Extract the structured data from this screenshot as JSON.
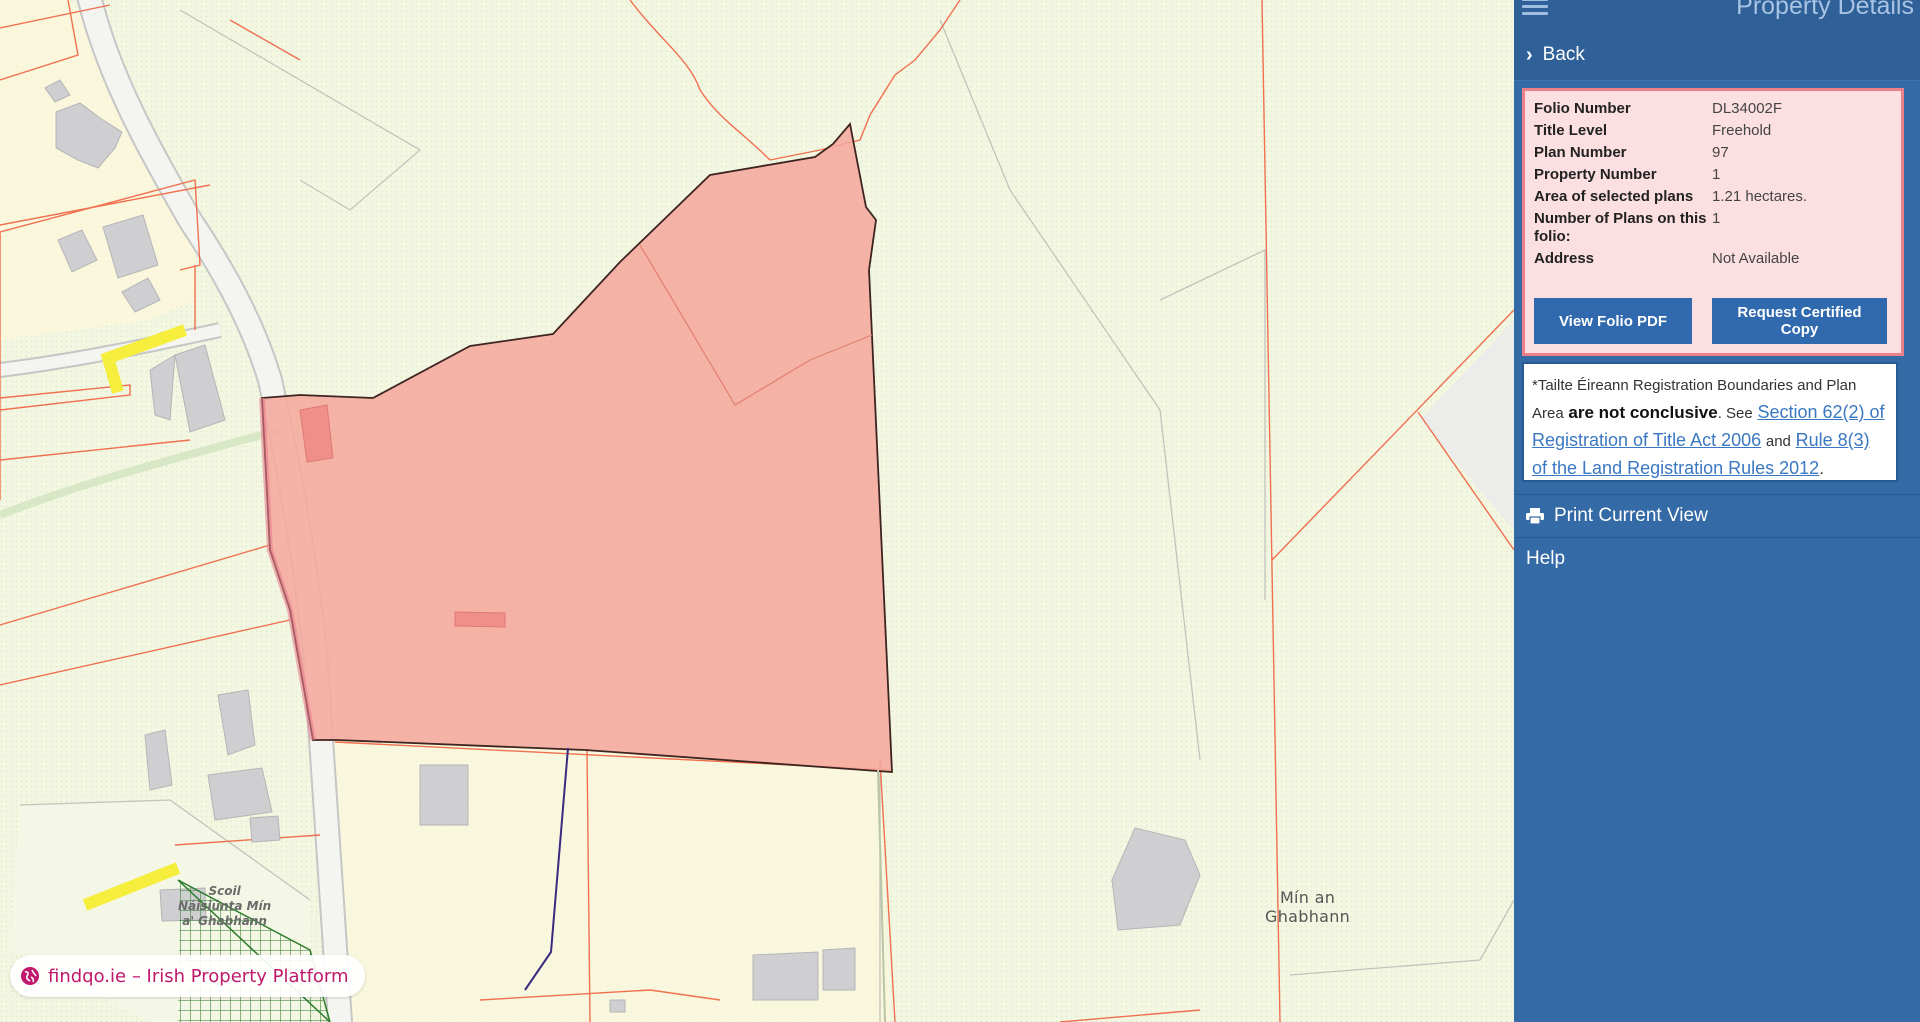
{
  "panel": {
    "title": "Property Details",
    "back_label": "Back",
    "details": [
      {
        "label": "Folio Number",
        "value": "DL34002F"
      },
      {
        "label": "Title Level",
        "value": "Freehold"
      },
      {
        "label": "Plan Number",
        "value": "97"
      },
      {
        "label": "Property Number",
        "value": "1"
      },
      {
        "label": "Area of selected plans",
        "value": "1.21 hectares."
      },
      {
        "label": "Number of Plans on this folio:",
        "value": "1"
      },
      {
        "label": "Address",
        "value": "Not Available"
      }
    ],
    "view_pdf_label": "View Folio PDF",
    "request_copy_label": "Request Certified Copy",
    "notice": {
      "part1": "*Tailte Éireann Registration Boundaries and Plan Area",
      "bold": "are not conclusive",
      "part2": ". See",
      "link1": "Section 62(2) of Registration of Title Act 2006",
      "and_text": "and",
      "link2": "Rule 8(3) of the Land Registration Rules 2012",
      "end": "."
    },
    "print_label": "Print Current View",
    "help_label": "Help"
  },
  "map": {
    "place_label_line1": "Mín an",
    "place_label_line2": "Ghabhann",
    "school_line1": "Scoil",
    "school_line2": "Náisiúnta Mín",
    "school_line3": "a' Ghabhann",
    "watermark_text": "findqo.ie – Irish Property Platform",
    "selected_parcel_color": "#f5a99d",
    "boundary_color": "#f07050"
  }
}
